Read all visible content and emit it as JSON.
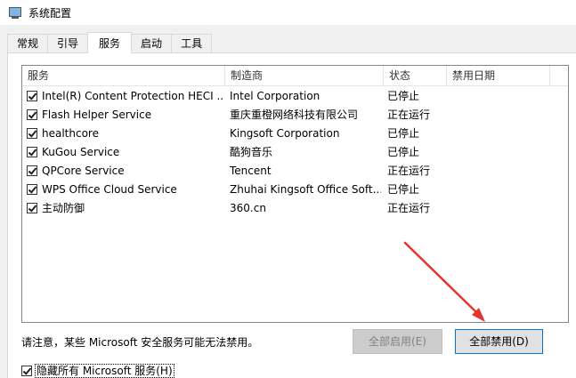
{
  "window": {
    "title": "系统配置"
  },
  "tabs": [
    {
      "label": "常规",
      "active": false
    },
    {
      "label": "引导",
      "active": false
    },
    {
      "label": "服务",
      "active": true
    },
    {
      "label": "启动",
      "active": false
    },
    {
      "label": "工具",
      "active": false
    }
  ],
  "table": {
    "columns": [
      "服务",
      "制造商",
      "状态",
      "禁用日期"
    ],
    "rows": [
      {
        "checked": true,
        "service": "Intel(R) Content Protection HECI ...",
        "maker": "Intel Corporation",
        "status": "已停止",
        "date": ""
      },
      {
        "checked": true,
        "service": "Flash Helper Service",
        "maker": "重庆重橙网络科技有限公司",
        "status": "正在运行",
        "date": ""
      },
      {
        "checked": true,
        "service": "healthcore",
        "maker": "Kingsoft Corporation",
        "status": "已停止",
        "date": ""
      },
      {
        "checked": true,
        "service": "KuGou Service",
        "maker": "酷狗音乐",
        "status": "已停止",
        "date": ""
      },
      {
        "checked": true,
        "service": "QPCore Service",
        "maker": "Tencent",
        "status": "正在运行",
        "date": ""
      },
      {
        "checked": true,
        "service": "WPS Office Cloud Service",
        "maker": "Zhuhai Kingsoft Office Soft...",
        "status": "已停止",
        "date": ""
      },
      {
        "checked": true,
        "service": "主动防御",
        "maker": "360.cn",
        "status": "正在运行",
        "date": ""
      }
    ]
  },
  "notice": "请注意，某些 Microsoft 安全服务可能无法禁用。",
  "buttons": {
    "enable_all": "全部启用(E)",
    "disable_all": "全部禁用(D)"
  },
  "hide_ms": {
    "checked": true,
    "label": "隐藏所有 Microsoft 服务(H)"
  },
  "colors": {
    "accent": "#0078d7",
    "annotation_arrow": "#e8322c"
  },
  "icons": {
    "app": "system-config-icon",
    "checkbox": "checkmark-icon",
    "annotation": "red-arrow-icon"
  }
}
